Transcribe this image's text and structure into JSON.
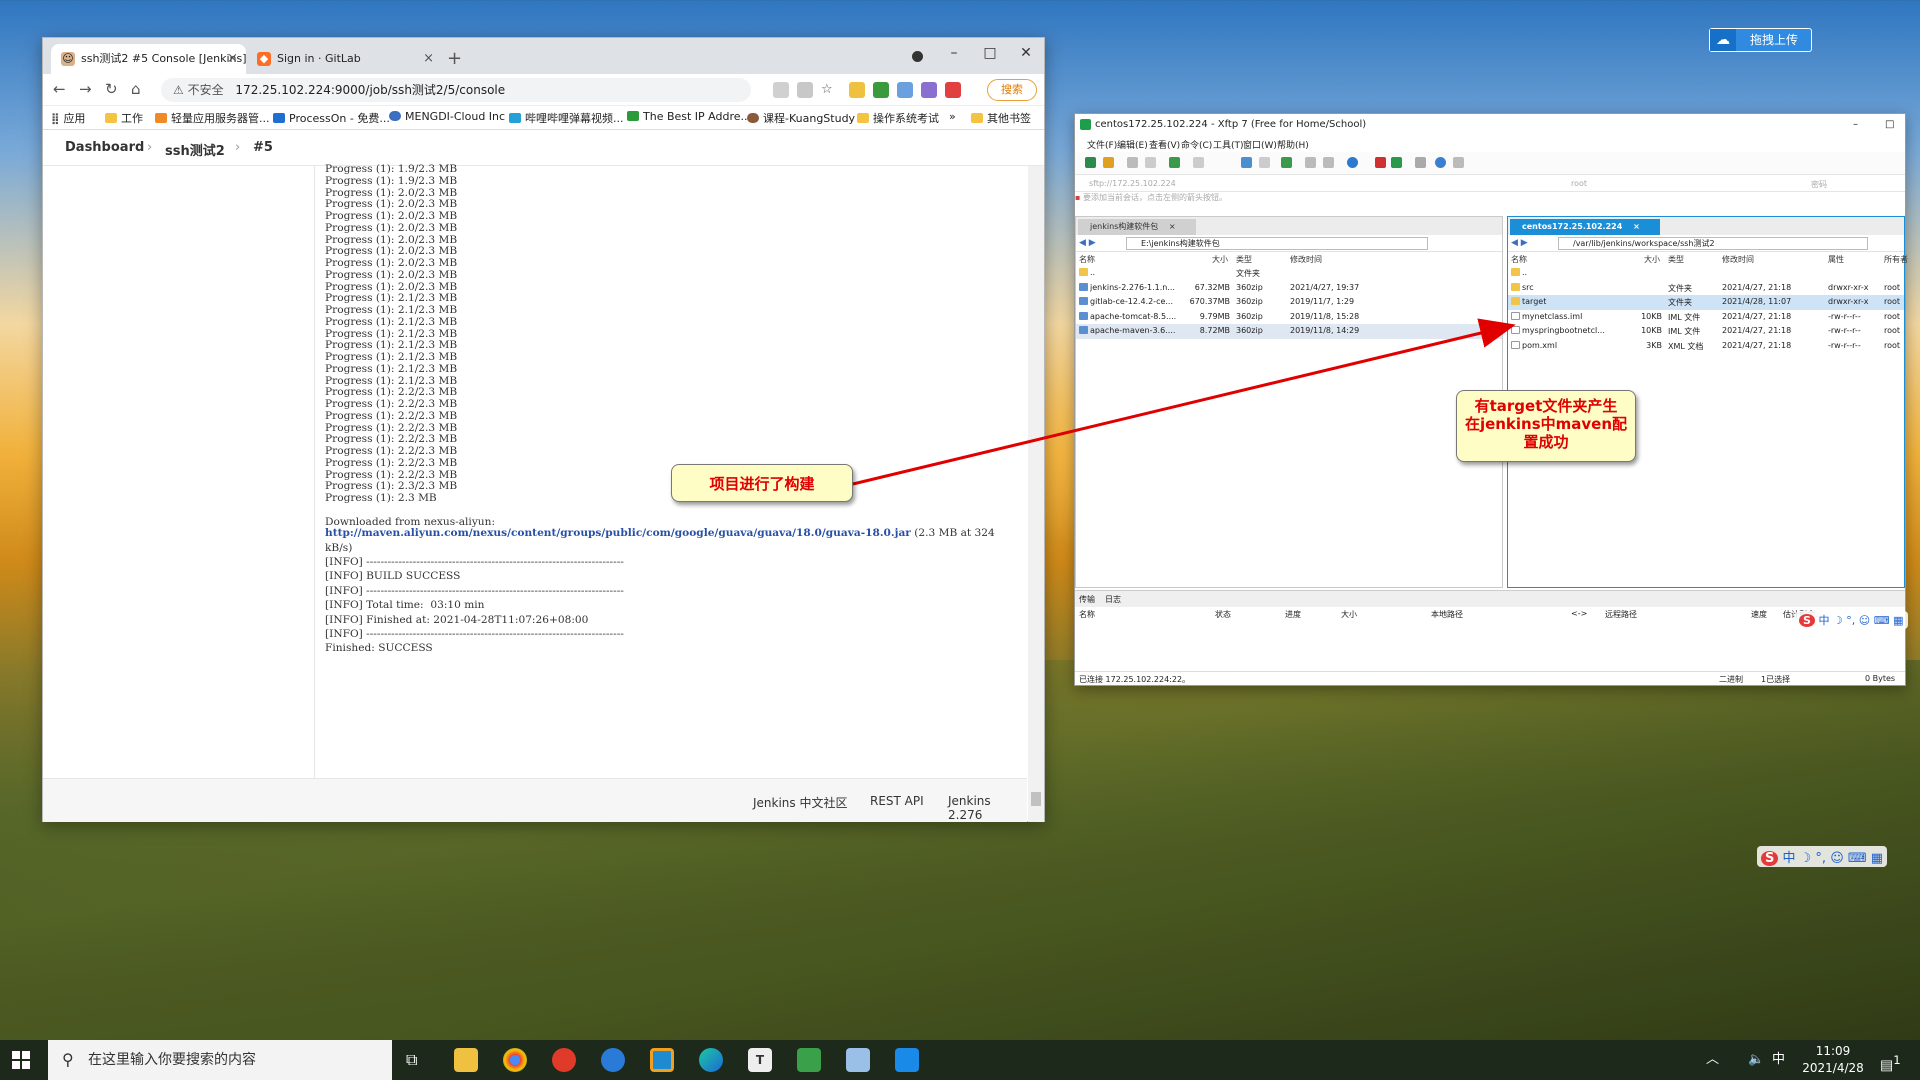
{
  "browser": {
    "tabs": [
      {
        "title": "ssh测试2 #5 Console [Jenkins]"
      },
      {
        "title": "Sign in · GitLab"
      }
    ],
    "new_tab": "+",
    "address": {
      "security_label": "不安全",
      "url": "172.25.102.224:9000/job/ssh测试2/5/console"
    },
    "search_button": "搜索",
    "bookmarks": [
      "应用",
      "工作",
      "轻量应用服务器管...",
      "ProcessOn - 免费...",
      "MENGDI-Cloud Inc",
      "哔哩哔哩弹幕视频...",
      "The Best IP Addre...",
      "课程-KuangStudy",
      "操作系统考试",
      "»",
      "其他书签"
    ]
  },
  "jenkins": {
    "breadcrumbs": [
      "Dashboard",
      "ssh测试2",
      "#5"
    ],
    "console_lines": [
      "Progress (1): 1.9/2.3 MB",
      "Progress (1): 1.9/2.3 MB",
      "Progress (1): 2.0/2.3 MB",
      "Progress (1): 2.0/2.3 MB",
      "Progress (1): 2.0/2.3 MB",
      "Progress (1): 2.0/2.3 MB",
      "Progress (1): 2.0/2.3 MB",
      "Progress (1): 2.0/2.3 MB",
      "Progress (1): 2.0/2.3 MB",
      "Progress (1): 2.0/2.3 MB",
      "Progress (1): 2.0/2.3 MB",
      "Progress (1): 2.1/2.3 MB",
      "Progress (1): 2.1/2.3 MB",
      "Progress (1): 2.1/2.3 MB",
      "Progress (1): 2.1/2.3 MB",
      "Progress (1): 2.1/2.3 MB",
      "Progress (1): 2.1/2.3 MB",
      "Progress (1): 2.1/2.3 MB",
      "Progress (1): 2.1/2.3 MB",
      "Progress (1): 2.2/2.3 MB",
      "Progress (1): 2.2/2.3 MB",
      "Progress (1): 2.2/2.3 MB",
      "Progress (1): 2.2/2.3 MB",
      "Progress (1): 2.2/2.3 MB",
      "Progress (1): 2.2/2.3 MB",
      "Progress (1): 2.2/2.3 MB",
      "Progress (1): 2.2/2.3 MB",
      "Progress (1): 2.3/2.3 MB",
      "Progress (1): 2.3 MB",
      "",
      "Downloaded from nexus-aliyun:"
    ],
    "download_url": "http://maven.aliyun.com/nexus/content/groups/public/com/google/guava/guava/18.0/guava-18.0.jar",
    "download_suffix": " (2.3 MB at 324",
    "download_suffix2": "kB/s)",
    "tail_lines": [
      "[INFO] ------------------------------------------------------------------------",
      "[INFO] BUILD SUCCESS",
      "[INFO] ------------------------------------------------------------------------",
      "[INFO] Total time:  03:10 min",
      "[INFO] Finished at: 2021-04-28T11:07:26+08:00",
      "[INFO] ------------------------------------------------------------------------",
      "Finished: SUCCESS"
    ],
    "footer": {
      "community": "Jenkins 中文社区",
      "rest_api": "REST API",
      "version": "Jenkins 2.276"
    }
  },
  "xftp": {
    "title": "centos172.25.102.224 - Xftp 7 (Free for Home/School)",
    "menu": [
      "文件(F)",
      "编辑(E)",
      "查看(V)",
      "命令(C)",
      "工具(T)",
      "窗口(W)",
      "帮助(H)"
    ],
    "address_placeholder": "sftp://172.25.102.224",
    "user_placeholder": "root",
    "password_placeholder": "密码",
    "hint": "要添加当前会话，点击左侧的箭头按钮。",
    "left": {
      "tab": "jenkins构建软件包",
      "path": "E:\\jenkins构建软件包",
      "columns": [
        "名称",
        "大小",
        "类型",
        "修改时间"
      ],
      "rows": [
        {
          "name": "..",
          "size": "",
          "type": "文件夹",
          "modified": "",
          "icon": "up"
        },
        {
          "name": "jenkins-2.276-1.1.n...",
          "size": "67.32MB",
          "type": "360zip",
          "modified": "2021/4/27, 19:37",
          "icon": "zip"
        },
        {
          "name": "gitlab-ce-12.4.2-ce...",
          "size": "670.37MB",
          "type": "360zip",
          "modified": "2019/11/7, 1:29",
          "icon": "zip"
        },
        {
          "name": "apache-tomcat-8.5....",
          "size": "9.79MB",
          "type": "360zip",
          "modified": "2019/11/8, 15:28",
          "icon": "zip"
        },
        {
          "name": "apache-maven-3.6....",
          "size": "8.72MB",
          "type": "360zip",
          "modified": "2019/11/8, 14:29",
          "icon": "zip"
        }
      ]
    },
    "right": {
      "tab": "centos172.25.102.224",
      "path": "/var/lib/jenkins/workspace/ssh测试2",
      "columns": [
        "名称",
        "大小",
        "类型",
        "修改时间",
        "属性",
        "所有者"
      ],
      "rows": [
        {
          "name": "..",
          "size": "",
          "type": "",
          "modified": "",
          "attr": "",
          "owner": "",
          "icon": "up"
        },
        {
          "name": "src",
          "size": "",
          "type": "文件夹",
          "modified": "2021/4/27, 21:18",
          "attr": "drwxr-xr-x",
          "owner": "root",
          "icon": "folder"
        },
        {
          "name": "target",
          "size": "",
          "type": "文件夹",
          "modified": "2021/4/28, 11:07",
          "attr": "drwxr-xr-x",
          "owner": "root",
          "icon": "folder"
        },
        {
          "name": "mynetclass.iml",
          "size": "10KB",
          "type": "IML 文件",
          "modified": "2021/4/27, 21:18",
          "attr": "-rw-r--r--",
          "owner": "root",
          "icon": "file"
        },
        {
          "name": "myspringbootnetcl...",
          "size": "10KB",
          "type": "IML 文件",
          "modified": "2021/4/27, 21:18",
          "attr": "-rw-r--r--",
          "owner": "root",
          "icon": "file"
        },
        {
          "name": "pom.xml",
          "size": "3KB",
          "type": "XML 文档",
          "modified": "2021/4/27, 21:18",
          "attr": "-rw-r--r--",
          "owner": "root",
          "icon": "file"
        }
      ]
    },
    "transfer_tabs": [
      "传输",
      "日志"
    ],
    "transfer_columns": [
      "名称",
      "状态",
      "进度",
      "大小",
      "本地路径",
      "<->",
      "远程路径",
      "速度",
      "估计剩余..."
    ],
    "status": {
      "connected": "已连接 172.25.102.224:22。",
      "mode": "二进制",
      "selected": "1已选择",
      "bytes": "0 Bytes"
    }
  },
  "annotations": {
    "build": "项目进行了构建",
    "target": [
      "有target文件夹产生",
      "在jenkins中maven配",
      "置成功"
    ]
  },
  "desktop": {
    "upload_button": "拖拽上传",
    "ime_glyphs": "中 ☽ °, ☺ ⌨ ▦"
  },
  "taskbar": {
    "search_placeholder": "在这里输入你要搜索的内容",
    "ime": "中",
    "time": "11:09",
    "date": "2021/4/28",
    "notification_count": "1"
  }
}
